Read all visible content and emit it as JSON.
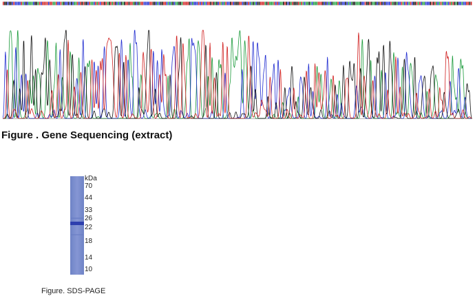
{
  "figure_sequencing": {
    "caption": "Figure . Gene Sequencing (extract)",
    "trace_colors": {
      "A": "#1a9a3a",
      "C": "#1f2bd0",
      "G": "#111111",
      "T": "#d02020"
    }
  },
  "figure_sds_page": {
    "caption": "Figure. SDS-PAGE",
    "unit": "kDa",
    "markers": [
      "70",
      "44",
      "33",
      "26",
      "22",
      "18",
      "14",
      "10"
    ],
    "gel_color": "#7c8fcf",
    "band_color": "#2d3fae"
  }
}
